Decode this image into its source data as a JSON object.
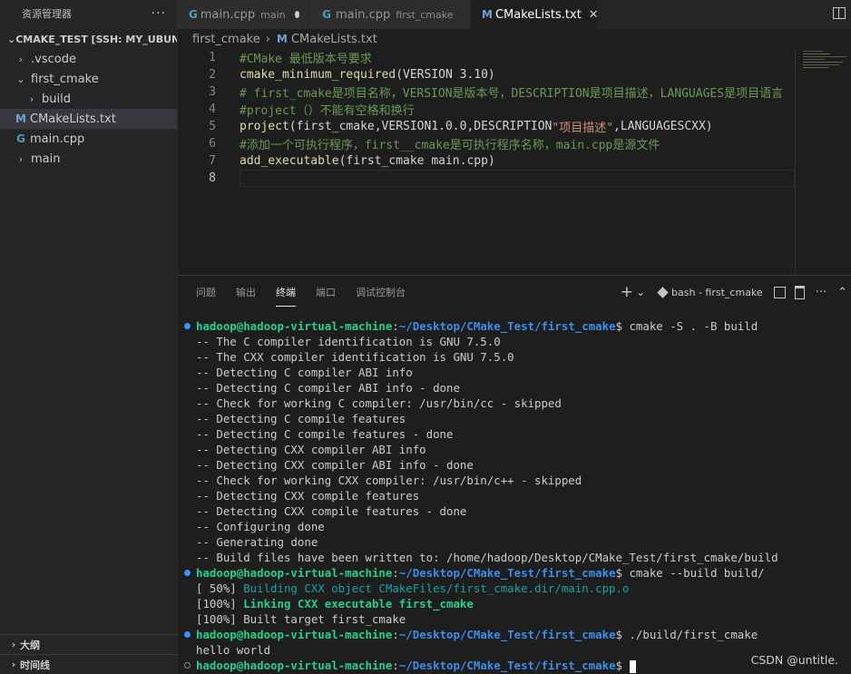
{
  "sidebar": {
    "title": "资源管理器",
    "more": "···",
    "root": "CMAKE_TEST [SSH: MY_UBUNTU]",
    "items": [
      {
        "label": ".vscode",
        "chev": "›",
        "icon": ""
      },
      {
        "label": "first_cmake",
        "chev": "⌄",
        "icon": ""
      },
      {
        "label": "build",
        "chev": "›",
        "icon": ""
      },
      {
        "label": "CMakeLists.txt",
        "chev": "",
        "icon": "M"
      },
      {
        "label": "main.cpp",
        "chev": "",
        "icon": "G"
      },
      {
        "label": "main",
        "chev": "›",
        "icon": ""
      }
    ],
    "outline": "大纲",
    "timeline": "时间线"
  },
  "tabs": [
    {
      "icon": "G",
      "label": "main.cpp",
      "desc": "main",
      "modified": true
    },
    {
      "icon": "G",
      "label": "main.cpp",
      "desc": "first_cmake",
      "modified": false
    },
    {
      "icon": "M",
      "label": "CMakeLists.txt",
      "desc": "",
      "close": "✕"
    }
  ],
  "breadcrumb": {
    "folder": "first_cmake",
    "sep": "›",
    "icon": "M",
    "file": "CMakeLists.txt"
  },
  "editor": {
    "lines": [
      {
        "n": "1",
        "segs": [
          {
            "t": "#CMake 最低版本号要求",
            "c": "#6a9955"
          }
        ]
      },
      {
        "n": "2",
        "segs": [
          {
            "t": "cmake_minimum_required",
            "c": "#dcdcaa"
          },
          {
            "t": "(VERSION 3.10)",
            "c": "#d4d4d4"
          }
        ]
      },
      {
        "n": "3",
        "segs": [
          {
            "t": "# first_cmake是项目名称，VERSION是版本号，DESCRIPTION是项目描述，LANGUAGES是项目语言",
            "c": "#6a9955"
          }
        ]
      },
      {
        "n": "4",
        "segs": [
          {
            "t": "#project（）不能有空格和换行",
            "c": "#6a9955"
          }
        ]
      },
      {
        "n": "5",
        "segs": [
          {
            "t": "project",
            "c": "#dcdcaa"
          },
          {
            "t": "(first_cmake,VERSION1.0.0,DESCRIPTION",
            "c": "#d4d4d4"
          },
          {
            "t": "\"项目描述\"",
            "c": "#ce9178"
          },
          {
            "t": ",LANGUAGESCXX)",
            "c": "#d4d4d4"
          }
        ]
      },
      {
        "n": "6",
        "segs": [
          {
            "t": "#添加一个可执行程序，first__cmake是可执行程序名称，main.cpp是源文件",
            "c": "#6a9955"
          }
        ]
      },
      {
        "n": "7",
        "segs": [
          {
            "t": "add_executable",
            "c": "#dcdcaa"
          },
          {
            "t": "(first_cmake main.cpp)",
            "c": "#d4d4d4"
          }
        ]
      },
      {
        "n": "8",
        "segs": []
      }
    ]
  },
  "panel": {
    "tabs": [
      "问题",
      "输出",
      "终端",
      "端口",
      "调试控制台"
    ],
    "active": 2,
    "add": "+",
    "dropdown": "⌄",
    "shell": "bash - first_cmake",
    "more": "···",
    "collapse": "⌃"
  },
  "terminal": {
    "prompt_user": "hadoop@hadoop-virtual-machine",
    "prompt_path": "~/Desktop/CMake_Test/first_cmake",
    "lines": [
      {
        "type": "prompt",
        "bullet": "blue",
        "cmd": " cmake -S . -B build"
      },
      {
        "type": "out",
        "text": "-- The C compiler identification is GNU 7.5.0"
      },
      {
        "type": "out",
        "text": "-- The CXX compiler identification is GNU 7.5.0"
      },
      {
        "type": "out",
        "text": "-- Detecting C compiler ABI info"
      },
      {
        "type": "out",
        "text": "-- Detecting C compiler ABI info - done"
      },
      {
        "type": "out",
        "text": "-- Check for working C compiler: /usr/bin/cc - skipped"
      },
      {
        "type": "out",
        "text": "-- Detecting C compile features"
      },
      {
        "type": "out",
        "text": "-- Detecting C compile features - done"
      },
      {
        "type": "out",
        "text": "-- Detecting CXX compiler ABI info"
      },
      {
        "type": "out",
        "text": "-- Detecting CXX compiler ABI info - done"
      },
      {
        "type": "out",
        "text": "-- Check for working CXX compiler: /usr/bin/c++ - skipped"
      },
      {
        "type": "out",
        "text": "-- Detecting CXX compile features"
      },
      {
        "type": "out",
        "text": "-- Detecting CXX compile features - done"
      },
      {
        "type": "out",
        "text": "-- Configuring done"
      },
      {
        "type": "out",
        "text": "-- Generating done"
      },
      {
        "type": "out",
        "text": "-- Build files have been written to: /home/hadoop/Desktop/CMake_Test/first_cmake/build"
      },
      {
        "type": "prompt",
        "bullet": "blue",
        "cmd": " cmake --build build/"
      },
      {
        "type": "build",
        "pct": "[ 50%] ",
        "text": "Building CXX object CMakeFiles/first_cmake.dir/main.cpp.o",
        "color": "#16a3a3"
      },
      {
        "type": "build",
        "pct": "[100%] ",
        "text": "Linking CXX executable first_cmake",
        "color": "#23d18b",
        "bold": true
      },
      {
        "type": "out",
        "text": "[100%] Built target first_cmake"
      },
      {
        "type": "prompt",
        "bullet": "blue",
        "cmd": " ./build/first_cmake"
      },
      {
        "type": "out",
        "text": "hello world"
      },
      {
        "type": "prompt",
        "bullet": "hollow",
        "cmd": "",
        "cursor": true
      }
    ]
  },
  "watermark": "CSDN @untitle."
}
